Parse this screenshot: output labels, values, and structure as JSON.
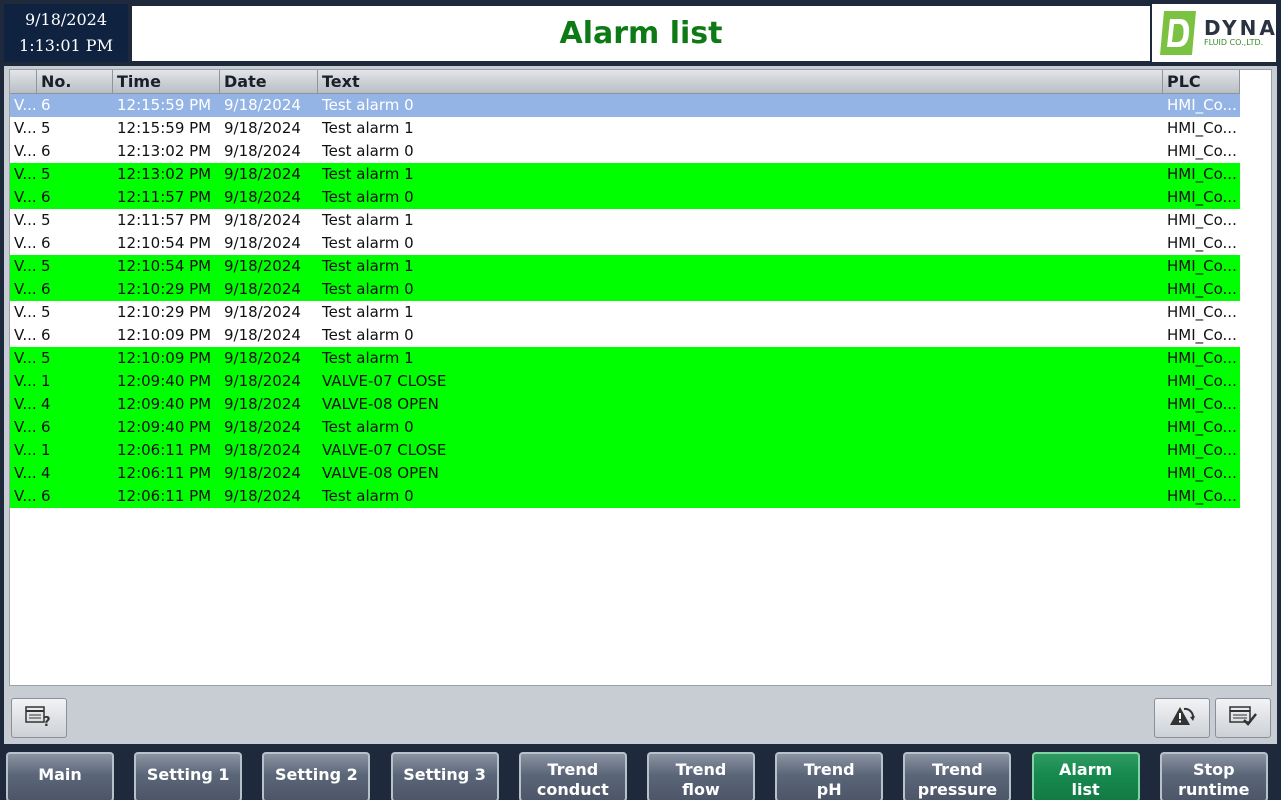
{
  "header": {
    "date": "9/18/2024",
    "time": "1:13:01 PM",
    "title": "Alarm list",
    "logo_brand": "DYNA",
    "logo_sub": "FLUID CO.,LTD."
  },
  "colors": {
    "title": "#0e7a16",
    "selected_row": "#94b4e6",
    "active_alarm_row": "#00ff00",
    "active_nav": "#168a4e"
  },
  "table": {
    "columns": [
      "",
      "No.",
      "Time",
      "Date",
      "Text",
      "PLC"
    ],
    "rows": [
      {
        "status": "V...",
        "no": "6",
        "time": "12:15:59 PM",
        "date": "9/18/2024",
        "text": "Test alarm 0",
        "plc": "HMI_Co...",
        "style": "sel"
      },
      {
        "status": "V...",
        "no": "5",
        "time": "12:15:59 PM",
        "date": "9/18/2024",
        "text": "Test alarm 1",
        "plc": "HMI_Co...",
        "style": "white"
      },
      {
        "status": "V...",
        "no": "6",
        "time": "12:13:02 PM",
        "date": "9/18/2024",
        "text": "Test alarm 0",
        "plc": "HMI_Co...",
        "style": "white"
      },
      {
        "status": "V...",
        "no": "5",
        "time": "12:13:02 PM",
        "date": "9/18/2024",
        "text": "Test alarm 1",
        "plc": "HMI_Co...",
        "style": "green"
      },
      {
        "status": "V...",
        "no": "6",
        "time": "12:11:57 PM",
        "date": "9/18/2024",
        "text": "Test alarm 0",
        "plc": "HMI_Co...",
        "style": "green"
      },
      {
        "status": "V...",
        "no": "5",
        "time": "12:11:57 PM",
        "date": "9/18/2024",
        "text": "Test alarm 1",
        "plc": "HMI_Co...",
        "style": "white"
      },
      {
        "status": "V...",
        "no": "6",
        "time": "12:10:54 PM",
        "date": "9/18/2024",
        "text": "Test alarm 0",
        "plc": "HMI_Co...",
        "style": "white"
      },
      {
        "status": "V...",
        "no": "5",
        "time": "12:10:54 PM",
        "date": "9/18/2024",
        "text": "Test alarm 1",
        "plc": "HMI_Co...",
        "style": "green"
      },
      {
        "status": "V...",
        "no": "6",
        "time": "12:10:29 PM",
        "date": "9/18/2024",
        "text": "Test alarm 0",
        "plc": "HMI_Co...",
        "style": "green"
      },
      {
        "status": "V...",
        "no": "5",
        "time": "12:10:29 PM",
        "date": "9/18/2024",
        "text": "Test alarm 1",
        "plc": "HMI_Co...",
        "style": "white"
      },
      {
        "status": "V...",
        "no": "6",
        "time": "12:10:09 PM",
        "date": "9/18/2024",
        "text": "Test alarm 0",
        "plc": "HMI_Co...",
        "style": "white"
      },
      {
        "status": "V...",
        "no": "5",
        "time": "12:10:09 PM",
        "date": "9/18/2024",
        "text": "Test alarm 1",
        "plc": "HMI_Co...",
        "style": "green"
      },
      {
        "status": "V...",
        "no": "1",
        "time": "12:09:40 PM",
        "date": "9/18/2024",
        "text": "VALVE-07 CLOSE",
        "plc": "HMI_Co...",
        "style": "green"
      },
      {
        "status": "V...",
        "no": "4",
        "time": "12:09:40 PM",
        "date": "9/18/2024",
        "text": "VALVE-08 OPEN",
        "plc": "HMI_Co...",
        "style": "green"
      },
      {
        "status": "V...",
        "no": "6",
        "time": "12:09:40 PM",
        "date": "9/18/2024",
        "text": "Test alarm 0",
        "plc": "HMI_Co...",
        "style": "green"
      },
      {
        "status": "V...",
        "no": "1",
        "time": "12:06:11 PM",
        "date": "9/18/2024",
        "text": "VALVE-07 CLOSE",
        "plc": "HMI_Co...",
        "style": "green"
      },
      {
        "status": "V...",
        "no": "4",
        "time": "12:06:11 PM",
        "date": "9/18/2024",
        "text": "VALVE-08 OPEN",
        "plc": "HMI_Co...",
        "style": "green"
      },
      {
        "status": "V...",
        "no": "6",
        "time": "12:06:11 PM",
        "date": "9/18/2024",
        "text": "Test alarm 0",
        "plc": "HMI_Co...",
        "style": "green"
      }
    ]
  },
  "toolbar": {
    "left_icons": [
      "alarm-info-icon"
    ],
    "right_icons": [
      "acknowledge-icon",
      "edit-table-icon"
    ]
  },
  "nav": [
    {
      "lines": [
        "Main"
      ],
      "active": false
    },
    {
      "lines": [
        "Setting 1"
      ],
      "active": false
    },
    {
      "lines": [
        "Setting 2"
      ],
      "active": false
    },
    {
      "lines": [
        "Setting 3"
      ],
      "active": false
    },
    {
      "lines": [
        "Trend",
        "conduct"
      ],
      "active": false
    },
    {
      "lines": [
        "Trend",
        "flow"
      ],
      "active": false
    },
    {
      "lines": [
        "Trend",
        "pH"
      ],
      "active": false
    },
    {
      "lines": [
        "Trend",
        "pressure"
      ],
      "active": false
    },
    {
      "lines": [
        "Alarm",
        "list"
      ],
      "active": true
    },
    {
      "lines": [
        "Stop",
        "runtime"
      ],
      "active": false
    }
  ]
}
